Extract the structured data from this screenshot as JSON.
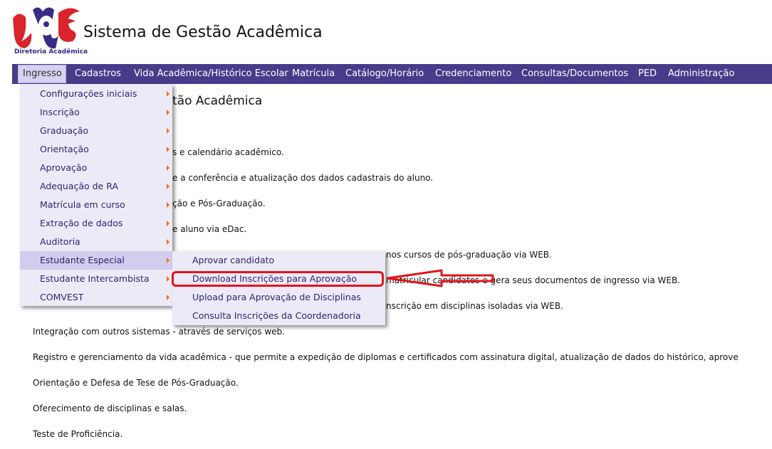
{
  "header": {
    "logo_caption": "Diretoria Acadêmica",
    "title": "Sistema de Gestão Acadêmica"
  },
  "menubar": {
    "items": [
      {
        "label": "Ingresso"
      },
      {
        "label": "Cadastros"
      },
      {
        "label": "Vida Acadêmica/Histórico Escolar"
      },
      {
        "label": "Matrícula"
      },
      {
        "label": "Catálogo/Horário"
      },
      {
        "label": "Credenciamento"
      },
      {
        "label": "Consultas/Documentos"
      },
      {
        "label": "PED"
      },
      {
        "label": "Administração"
      }
    ],
    "active": "Ingresso"
  },
  "ingresso_menu": {
    "items": [
      {
        "label": "Configurações iniciais"
      },
      {
        "label": "Inscrição"
      },
      {
        "label": "Graduação"
      },
      {
        "label": "Orientação"
      },
      {
        "label": "Aprovação"
      },
      {
        "label": "Adequação de RA"
      },
      {
        "label": "Matrícula em curso"
      },
      {
        "label": "Extração de dados"
      },
      {
        "label": "Auditoria"
      },
      {
        "label": "Estudante Especial"
      },
      {
        "label": "Estudante Intercambista"
      },
      {
        "label": "COMVEST"
      }
    ],
    "selected": "Estudante Especial"
  },
  "estudante_especial_menu": {
    "items": [
      {
        "label": "Aprovar candidato"
      },
      {
        "label": "Download Inscrições para Aprovação"
      },
      {
        "label": "Upload para Aprovação de Disciplinas"
      },
      {
        "label": "Consulta Inscrições da Coordenadoria"
      }
    ],
    "highlighted": "Download Inscrições para Aprovação"
  },
  "content": {
    "heading": "tão Acadêmica",
    "lines": [
      "s e calendário acadêmico.",
      "e a conferência e atualização dos dados cadastrais do aluno.",
      "ção e Pós-Graduação.",
      "e aluno via eDac.",
      "nos cursos de pós-graduação via WEB.",
      "matricular candidatos e gera seus documentos de ingresso via WEB.",
      "nscrição em disciplinas isoladas via WEB.",
      "Integração com outros sistemas - através de serviços web.",
      "Registro e gerenciamento da vida acadêmica - que permite a expedição de diplomas e certificados com assinatura digital, atualização de dados do histórico, aprove",
      "Orientação e Defesa de Tese de Pós-Graduação.",
      "Oferecimento de disciplinas e salas.",
      "Teste de Proficiência."
    ]
  },
  "colors": {
    "menubar_bg": "#4a3a8a",
    "menu_bg": "#edeaf8",
    "menu_text": "#2e2470",
    "annotation_red": "#e0151b",
    "submenu_arrow": "#e8701a"
  }
}
